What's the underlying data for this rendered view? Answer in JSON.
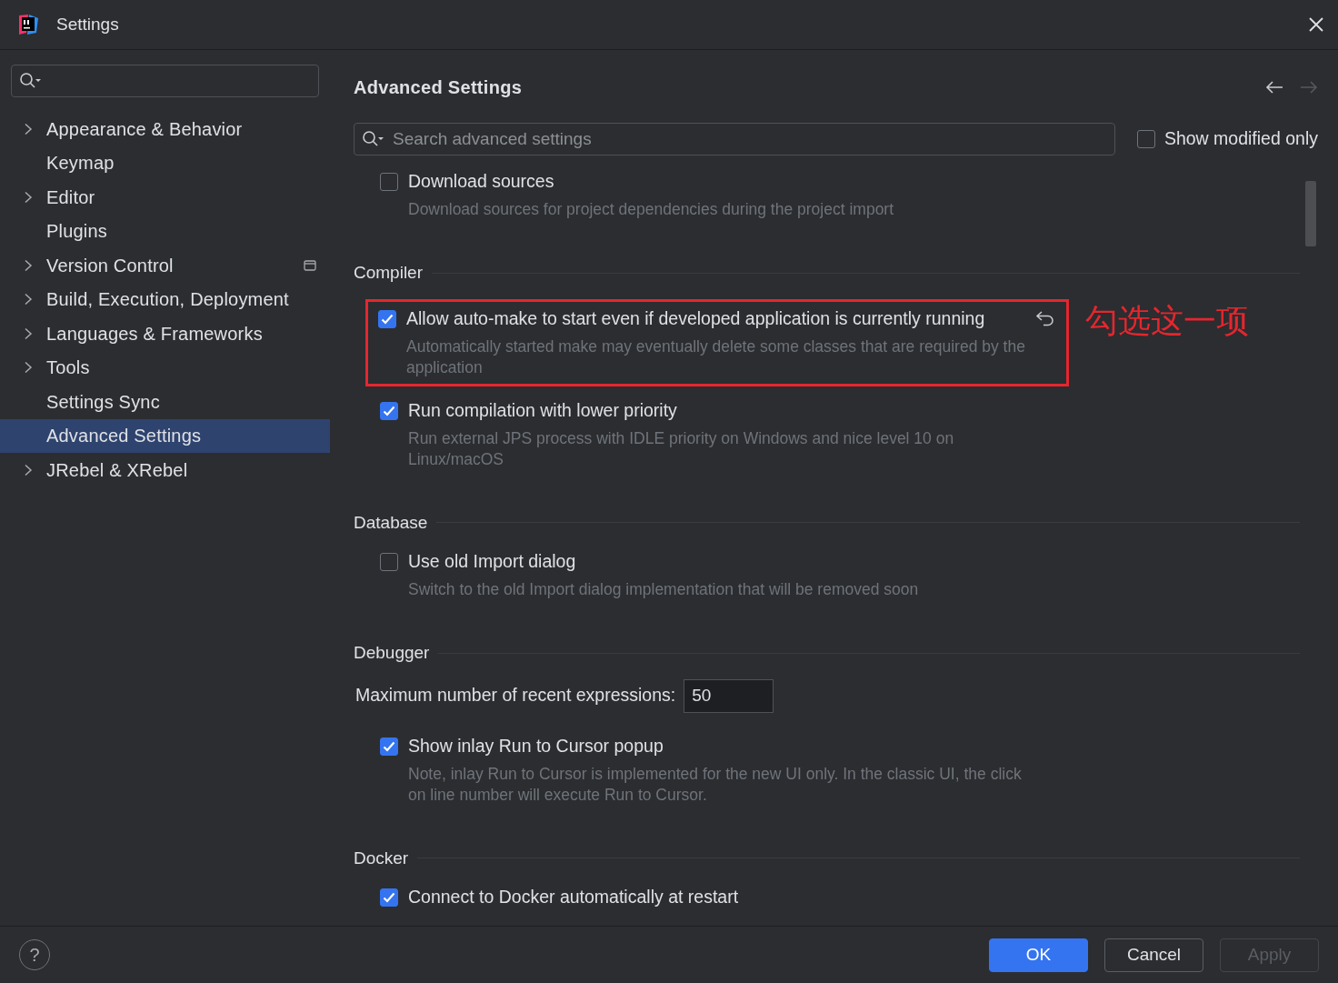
{
  "window": {
    "title": "Settings"
  },
  "sidebar": {
    "items": [
      {
        "label": "Appearance & Behavior",
        "expandable": true,
        "selected": false,
        "scope_icon": false
      },
      {
        "label": "Keymap",
        "expandable": false,
        "selected": false,
        "scope_icon": false
      },
      {
        "label": "Editor",
        "expandable": true,
        "selected": false,
        "scope_icon": false
      },
      {
        "label": "Plugins",
        "expandable": false,
        "selected": false,
        "scope_icon": false
      },
      {
        "label": "Version Control",
        "expandable": true,
        "selected": false,
        "scope_icon": true
      },
      {
        "label": "Build, Execution, Deployment",
        "expandable": true,
        "selected": false,
        "scope_icon": false
      },
      {
        "label": "Languages & Frameworks",
        "expandable": true,
        "selected": false,
        "scope_icon": false
      },
      {
        "label": "Tools",
        "expandable": true,
        "selected": false,
        "scope_icon": false
      },
      {
        "label": "Settings Sync",
        "expandable": false,
        "selected": false,
        "scope_icon": false
      },
      {
        "label": "Advanced Settings",
        "expandable": false,
        "selected": true,
        "scope_icon": false
      },
      {
        "label": "JRebel & XRebel",
        "expandable": true,
        "selected": false,
        "scope_icon": false
      }
    ]
  },
  "page": {
    "title": "Advanced Settings",
    "back_enabled": true,
    "forward_enabled": false,
    "search": {
      "placeholder": "Search advanced settings"
    },
    "modified_only": {
      "label": "Show modified only",
      "checked": false
    },
    "sections": [
      {
        "items": [
          {
            "kind": "checkbox",
            "label": "Download sources",
            "checked": false,
            "description": "Download sources for project dependencies during the project import"
          }
        ]
      },
      {
        "title": "Compiler",
        "items": [
          {
            "kind": "checkbox",
            "label": "Allow auto-make to start even if developed application is currently running",
            "checked": true,
            "modified": true,
            "highlighted": true,
            "annotation": "勾选这一项",
            "description": "Automatically started make may eventually delete some classes that are required by the application"
          },
          {
            "kind": "checkbox",
            "label": "Run compilation with lower priority",
            "checked": true,
            "description": "Run external JPS process with IDLE priority on Windows and nice level 10 on Linux/macOS"
          }
        ]
      },
      {
        "title": "Database",
        "items": [
          {
            "kind": "checkbox",
            "label": "Use old Import dialog",
            "checked": false,
            "description": "Switch to the old Import dialog implementation that will be removed soon"
          }
        ]
      },
      {
        "title": "Debugger",
        "items": [
          {
            "kind": "number",
            "label": "Maximum number of recent expressions:",
            "value": "50"
          },
          {
            "kind": "checkbox",
            "label": "Show inlay Run to Cursor popup",
            "checked": true,
            "description": "Note, inlay Run to Cursor is implemented for the new UI only. In the classic UI, the click on line number will execute Run to Cursor."
          }
        ]
      },
      {
        "title": "Docker",
        "items": [
          {
            "kind": "checkbox",
            "label": "Connect to Docker automatically at restart",
            "checked": true
          }
        ]
      }
    ]
  },
  "help": {
    "label": "?"
  },
  "buttons": [
    {
      "label": "OK",
      "kind": "primary",
      "disabled": false
    },
    {
      "label": "Cancel",
      "kind": "secondary",
      "disabled": false
    },
    {
      "label": "Apply",
      "kind": "secondary",
      "disabled": true
    }
  ]
}
